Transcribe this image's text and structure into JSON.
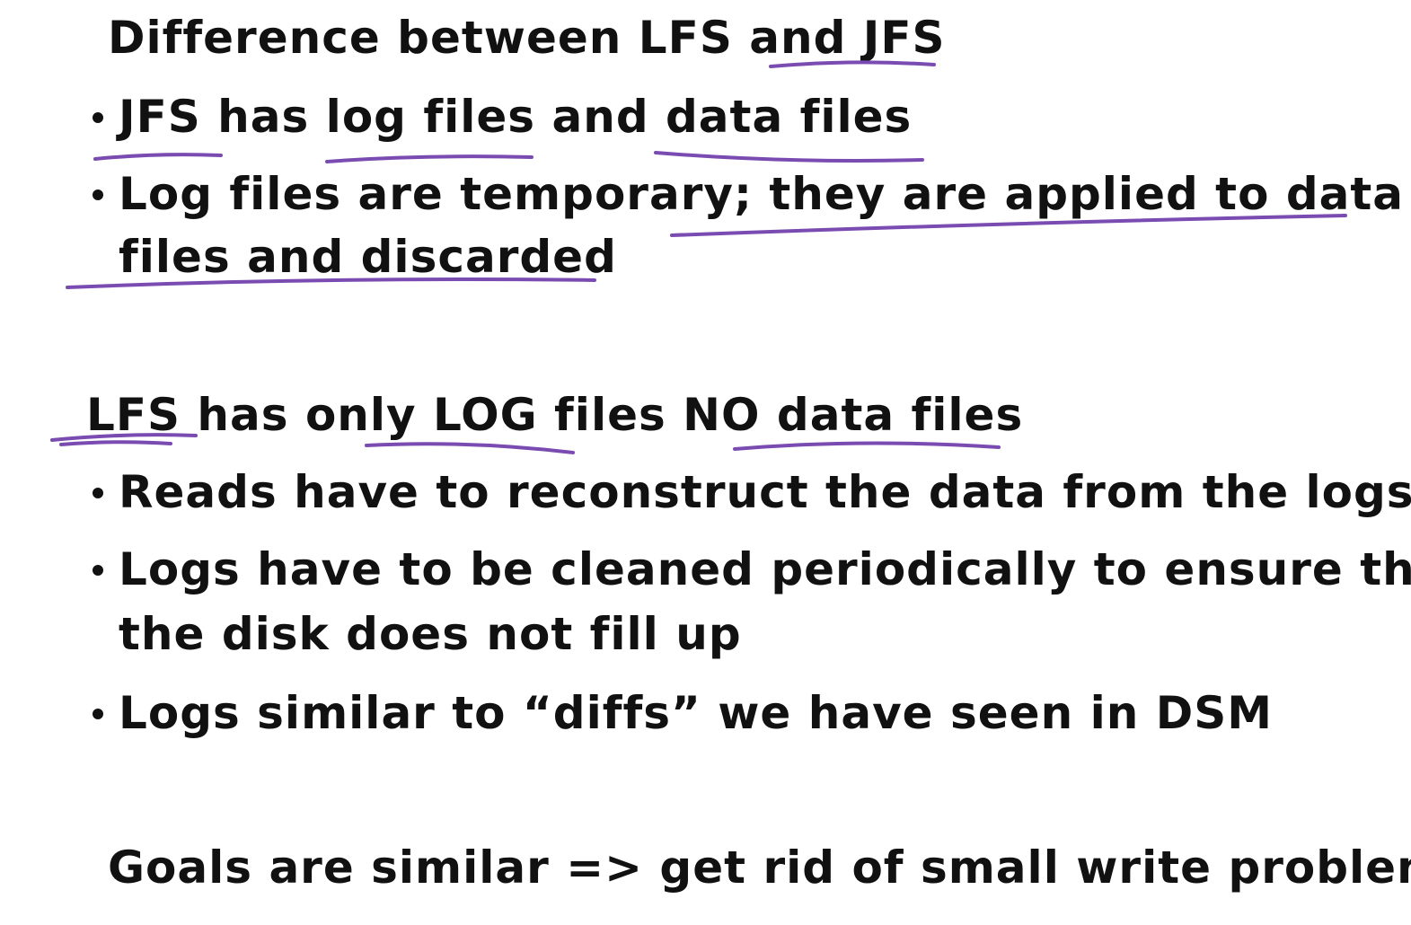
{
  "section1": {
    "heading": "Difference between LFS and JFS",
    "bullets": [
      "JFS has log files and data files",
      "Log files are temporary; they are applied to data",
      "files and discarded"
    ]
  },
  "section2": {
    "heading": "LFS has only LOG files NO data files",
    "bullets": [
      "Reads have to reconstruct the data from the logs",
      "Logs have to be cleaned periodically to ensure that",
      "the disk does not fill up",
      "Logs similar to “diffs” we have seen in DSM"
    ]
  },
  "footer": {
    "goals": "Goals are similar => get rid of small write problem"
  },
  "colors": {
    "ink": "#111111",
    "underline": "#7a4bb0"
  }
}
